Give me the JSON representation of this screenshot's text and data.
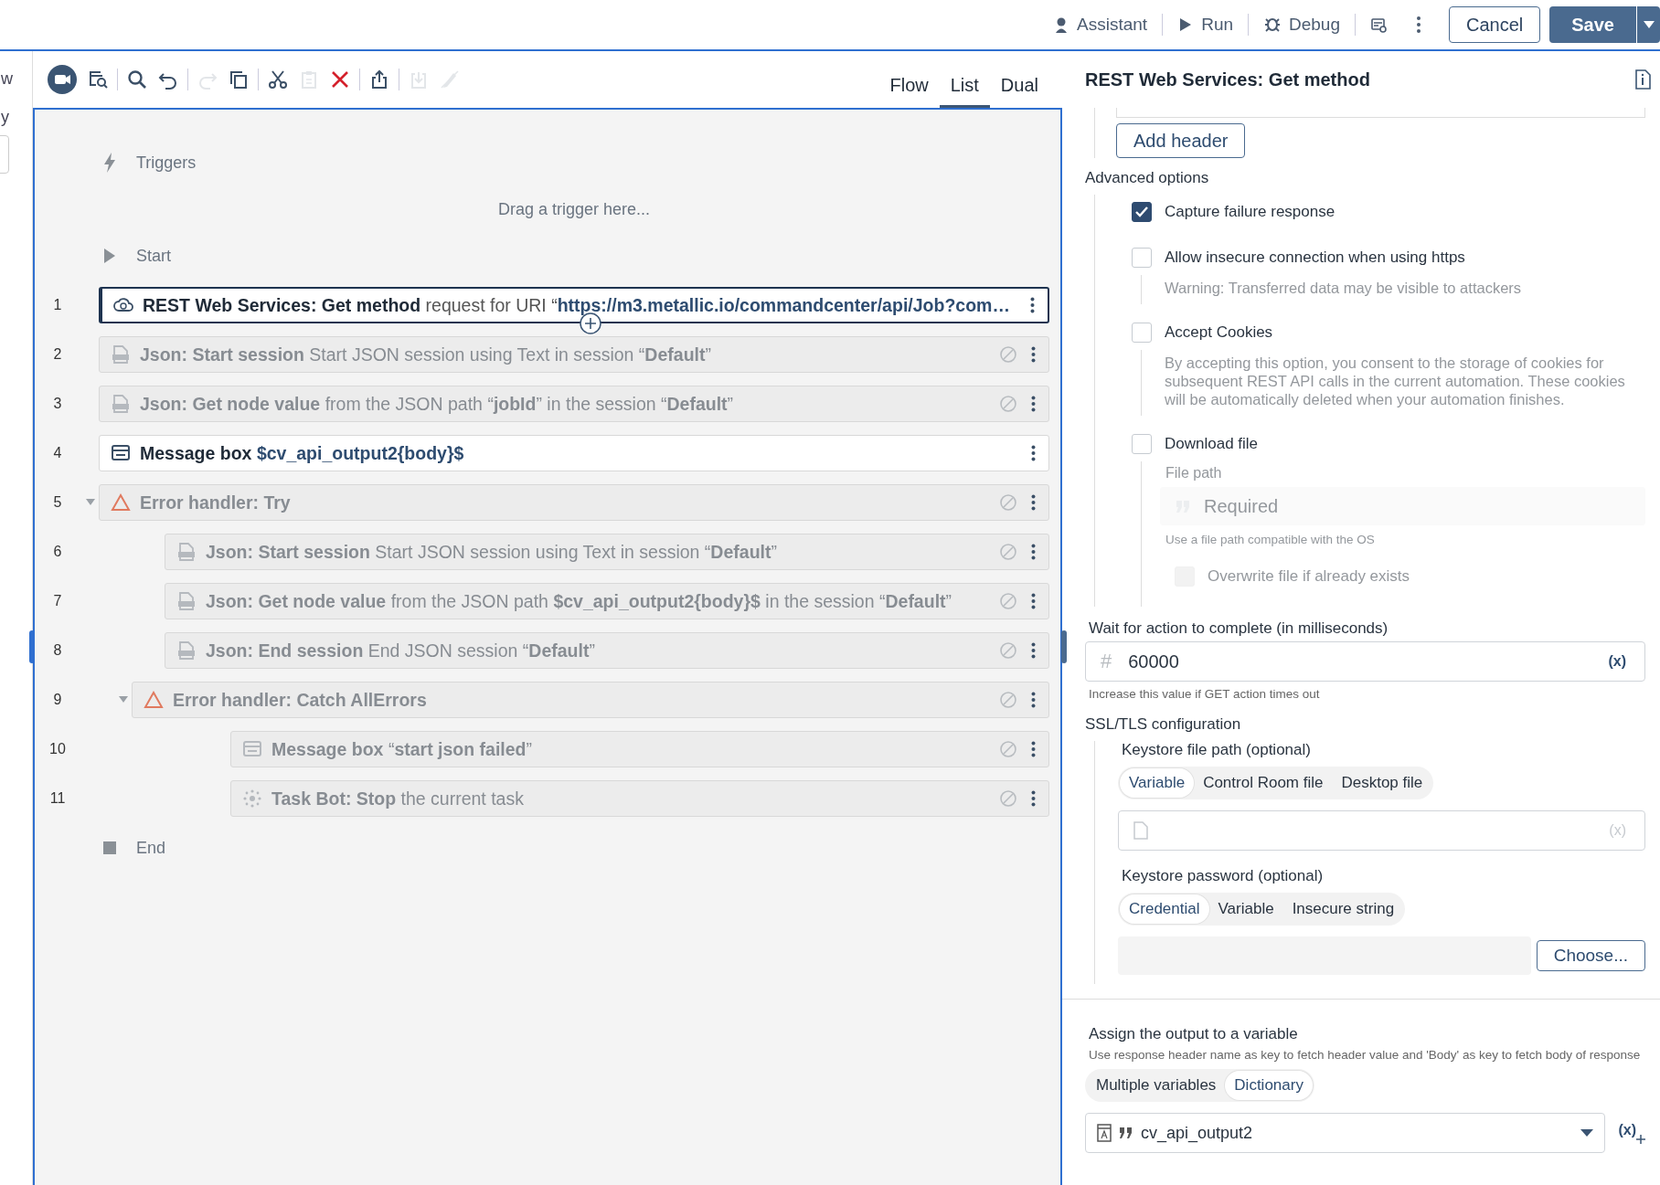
{
  "top_bar": {
    "actions": [
      {
        "kind": "assistant",
        "label": "Assistant"
      },
      {
        "kind": "run",
        "label": "Run"
      },
      {
        "kind": "debug",
        "label": "Debug"
      },
      {
        "kind": "variables"
      },
      {
        "kind": "more"
      }
    ],
    "cancel": "Cancel",
    "save": "Save"
  },
  "left_panel": {
    "fragments": [
      "w",
      "y"
    ]
  },
  "toolbar": {
    "tools": [
      {
        "kind": "record",
        "disabled": false
      },
      {
        "kind": "capture",
        "disabled": false
      },
      {
        "kind": "search",
        "disabled": false
      },
      {
        "kind": "undo",
        "disabled": false
      },
      {
        "kind": "redo",
        "disabled": true
      },
      {
        "kind": "copy",
        "disabled": false
      },
      {
        "kind": "cut",
        "disabled": false
      },
      {
        "kind": "paste",
        "disabled": true
      },
      {
        "kind": "delete",
        "disabled": false
      },
      {
        "kind": "export",
        "disabled": false
      },
      {
        "kind": "import",
        "disabled": true
      },
      {
        "kind": "disable",
        "disabled": true
      }
    ],
    "views": [
      {
        "label": "Flow",
        "selected": false
      },
      {
        "label": "List",
        "selected": true
      },
      {
        "label": "Dual",
        "selected": false
      }
    ]
  },
  "flow": {
    "triggers_label": "Triggers",
    "trigger_hint": "Drag a trigger here...",
    "start_label": "Start",
    "end_label": "End",
    "steps": [
      {
        "number": "1",
        "kind": "rest",
        "title": "REST Web Services: Get method",
        "detail": "request for URI “**https://m3.metallic.io/commandcenter/api/Job?com…**",
        "disabled": false,
        "selected": true
      },
      {
        "number": "2",
        "kind": "json",
        "title": "Json: Start session",
        "detail": "Start JSON session using Text in session “**Default**”",
        "disabled": true,
        "selected": false
      },
      {
        "number": "3",
        "kind": "json",
        "title": "Json: Get node value",
        "detail": "from the JSON path “**jobId**” in the session “**Default**”",
        "disabled": true,
        "selected": false
      },
      {
        "number": "4",
        "kind": "message",
        "title": "Message box",
        "detail": "**$cv_api_output2{body}$**",
        "disabled": false,
        "selected": false
      },
      {
        "number": "5",
        "kind": "try",
        "title": "Error handler: Try",
        "disabled": true,
        "selected": false,
        "expanded": true,
        "children": [
          {
            "number": "6",
            "kind": "json",
            "title": "Json: Start session",
            "detail": "Start JSON session using Text in session “**Default**”",
            "disabled": true,
            "selected": false
          },
          {
            "number": "7",
            "kind": "json",
            "title": "Json: Get node value",
            "detail": "from the JSON path **$cv_api_output2{body}$** in the session “**Default**”",
            "disabled": true,
            "selected": false
          },
          {
            "number": "8",
            "kind": "json",
            "title": "Json: End session",
            "detail": "End JSON session “**Default**”",
            "disabled": true,
            "selected": false
          },
          {
            "number": "9",
            "kind": "catch",
            "title": "Error handler: Catch AllErrors",
            "disabled": true,
            "selected": false,
            "expanded": true,
            "children": [
              {
                "number": "10",
                "kind": "message",
                "title": "Message box",
                "detail": "“**start json failed**”",
                "disabled": true,
                "selected": false
              },
              {
                "number": "11",
                "kind": "taskbot",
                "title": "Task Bot: Stop",
                "detail": "the current task",
                "disabled": true,
                "selected": false
              }
            ]
          }
        ]
      }
    ]
  },
  "properties": {
    "title": "REST Web Services: Get method",
    "add_header": "Add header",
    "advanced": {
      "label": "Advanced options",
      "options": [
        {
          "label": "Capture failure response",
          "checked": true
        },
        {
          "label": "Allow insecure connection when using https",
          "checked": false,
          "note": "Warning: Transferred data may be visible to attackers"
        },
        {
          "label": "Accept Cookies",
          "checked": false,
          "note": "By accepting this option, you consent to the storage of cookies for subsequent REST API calls in the current automation. These cookies will be automatically deleted when your automation finishes."
        },
        {
          "label": "Download file",
          "checked": false,
          "file_path": {
            "label": "File path",
            "placeholder": "Required",
            "hint": "Use a file path compatible with the OS"
          },
          "overwrite": {
            "label": "Overwrite file if already exists",
            "checked": false,
            "disabled": true
          }
        }
      ]
    },
    "wait": {
      "label": "Wait for action to complete (in milliseconds)",
      "prefix": "#",
      "value": "60000",
      "insert": "(x)",
      "hint": "Increase this value if GET action times out"
    },
    "ssl": {
      "label": "SSL/TLS configuration",
      "keystore_path": {
        "label": "Keystore file path (optional)",
        "modes": [
          {
            "label": "Variable",
            "selected": true
          },
          {
            "label": "Control Room file",
            "selected": false
          },
          {
            "label": "Desktop file",
            "selected": false
          }
        ],
        "insert": "(x)"
      },
      "keystore_password": {
        "label": "Keystore password (optional)",
        "modes": [
          {
            "label": "Credential",
            "selected": true
          },
          {
            "label": "Variable",
            "selected": false
          },
          {
            "label": "Insecure string",
            "selected": false
          }
        ],
        "choose": "Choose..."
      }
    },
    "output": {
      "label": "Assign the output to a variable",
      "hint": "Use response header name as key to fetch header value and 'Body' as key to fetch body of response",
      "modes": [
        {
          "label": "Multiple variables",
          "selected": false
        },
        {
          "label": "Dictionary",
          "selected": true
        }
      ],
      "variable": "cv_api_output2",
      "insert": "(x)"
    }
  }
}
